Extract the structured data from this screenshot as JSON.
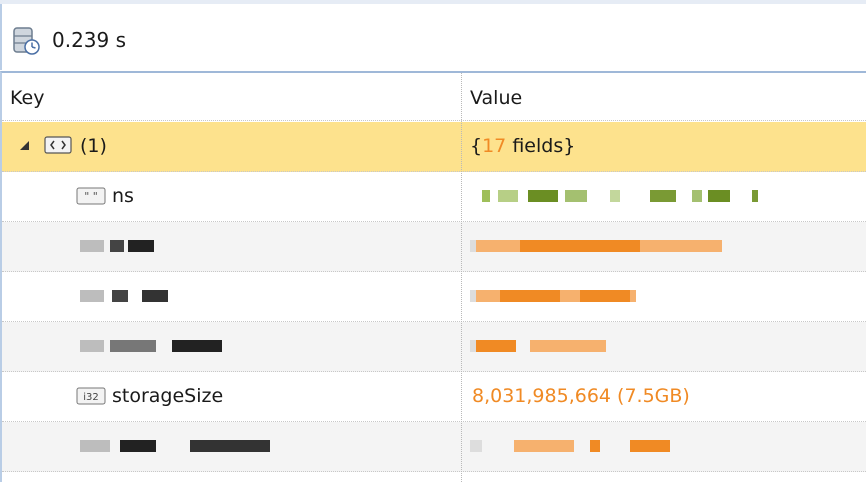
{
  "toolbar": {
    "icon": "database-clock-icon",
    "elapsed": "0.239 s"
  },
  "columns": {
    "key": "Key",
    "value": "Value"
  },
  "rows": [
    {
      "key": "(1)",
      "icon": "object-icon",
      "expanded": true,
      "value_prefix": "{",
      "value_count": "17",
      "value_suffix": " fields}"
    },
    {
      "key": "ns",
      "icon": "string-icon",
      "value_redacted": true
    },
    {
      "key_redacted": true,
      "value_redacted": true
    },
    {
      "key_redacted": true,
      "value_redacted": true
    },
    {
      "key_redacted": true,
      "value_redacted": true
    },
    {
      "key": "storageSize",
      "icon": "int32-icon",
      "icon_text": "i32",
      "value": "8,031,985,664 (7.5GB)"
    },
    {
      "key_redacted": true,
      "value_redacted": true
    }
  ],
  "colors": {
    "selected_row": "#fde28d",
    "number_value": "#f08a24",
    "string_value": "#6b8e23"
  }
}
